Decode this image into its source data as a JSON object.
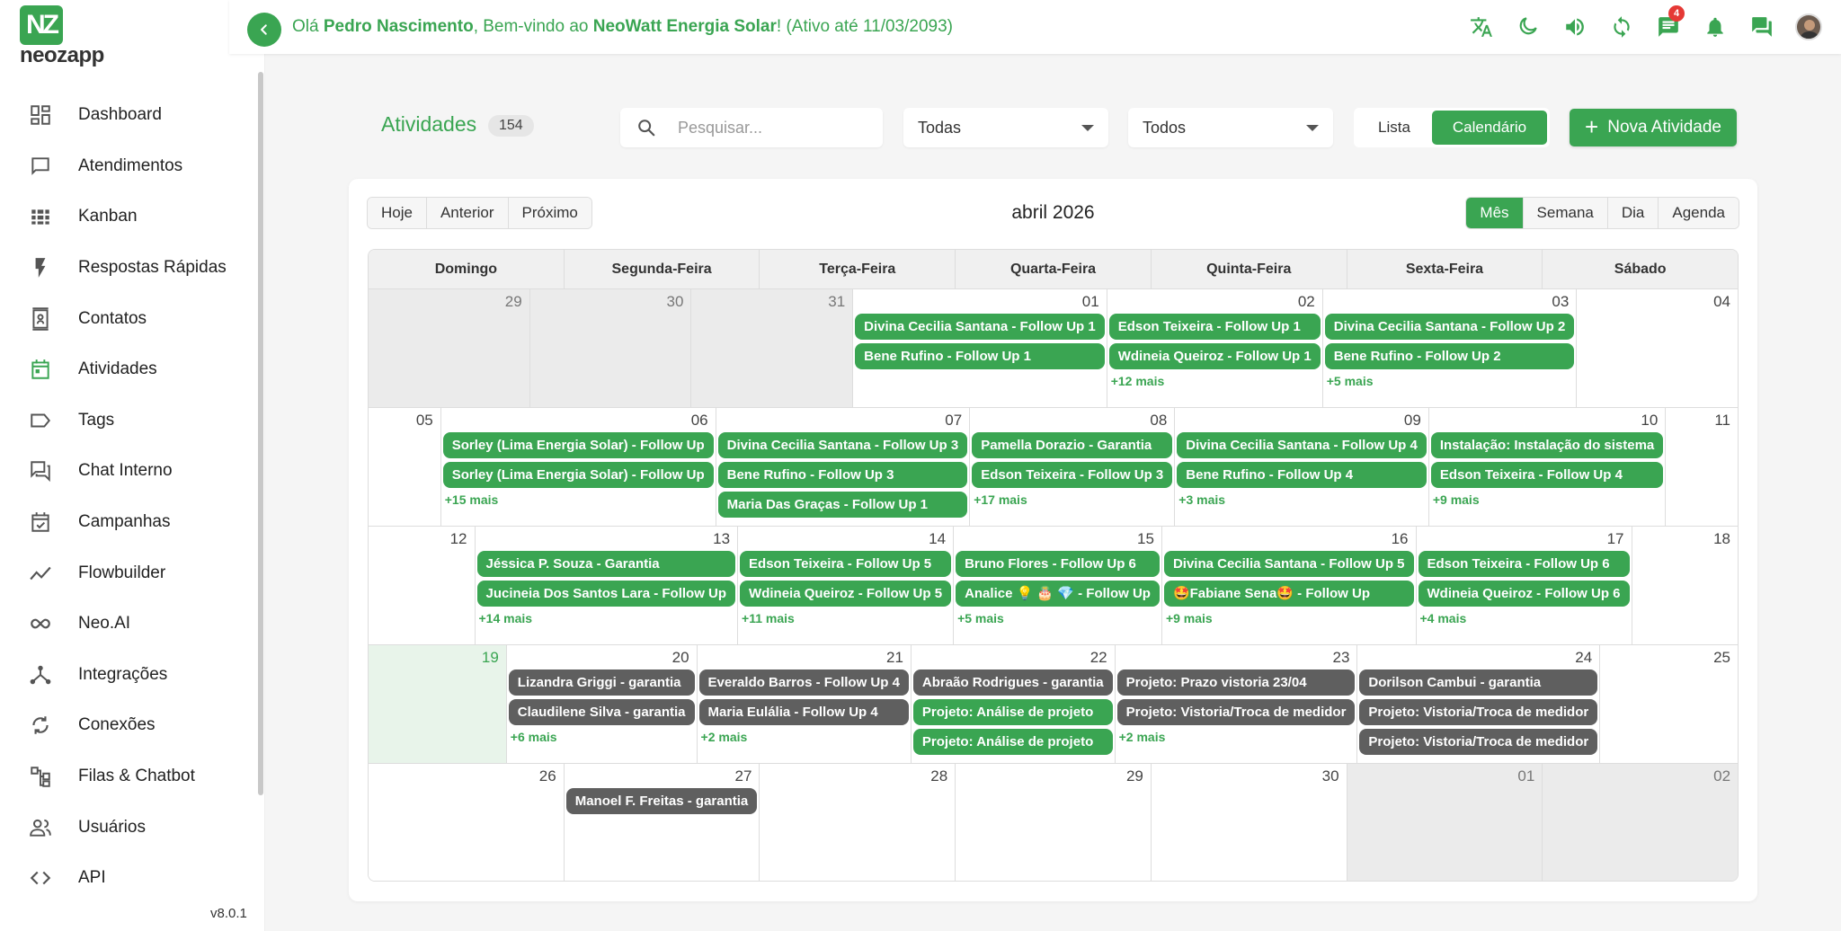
{
  "brand": {
    "logo_mark": "NZ",
    "logo_text": "neozapp",
    "version": "v8.0.1",
    "accent": "#3aa552"
  },
  "sidebar": {
    "items": [
      {
        "label": "Dashboard",
        "icon": "dashboard-icon"
      },
      {
        "label": "Atendimentos",
        "icon": "chat-bubble-icon"
      },
      {
        "label": "Kanban",
        "icon": "grid-icon"
      },
      {
        "label": "Respostas Rápidas",
        "icon": "bolt-icon"
      },
      {
        "label": "Contatos",
        "icon": "contacts-icon"
      },
      {
        "label": "Atividades",
        "icon": "calendar-icon"
      },
      {
        "label": "Tags",
        "icon": "tag-icon"
      },
      {
        "label": "Chat Interno",
        "icon": "forum-icon"
      },
      {
        "label": "Campanhas",
        "icon": "event-check-icon"
      },
      {
        "label": "Flowbuilder",
        "icon": "timeline-icon"
      },
      {
        "label": "Neo.AI",
        "icon": "infinity-icon"
      },
      {
        "label": "Integrações",
        "icon": "hub-icon"
      },
      {
        "label": "Conexões",
        "icon": "sync-icon"
      },
      {
        "label": "Filas & Chatbot",
        "icon": "flowchart-icon"
      },
      {
        "label": "Usuários",
        "icon": "users-icon"
      },
      {
        "label": "API",
        "icon": "code-icon"
      }
    ]
  },
  "header": {
    "greeting_prefix": "Olá ",
    "user_name": "Pedro Nascimento",
    "greeting_mid": ", Bem-vindo ao ",
    "company": "NeoWatt Energia Solar",
    "greeting_suffix": "! (Ativo até 11/03/2093)",
    "chat_badge": "4",
    "icons": [
      "translate-icon",
      "dark-mode-icon",
      "volume-icon",
      "refresh-icon",
      "chat-icon",
      "bell-icon",
      "forum-icon"
    ]
  },
  "toolbar": {
    "title": "Atividades",
    "count": "154",
    "search_placeholder": "Pesquisar...",
    "filter1": "Todas",
    "filter2": "Todos",
    "view_list": "Lista",
    "view_calendar": "Calendário",
    "new_activity": "Nova Atividade"
  },
  "calendar": {
    "nav": [
      "Hoje",
      "Anterior",
      "Próximo"
    ],
    "title": "abril 2026",
    "modes": [
      "Mês",
      "Semana",
      "Dia",
      "Agenda"
    ],
    "weekdays": [
      "Domingo",
      "Segunda-Feira",
      "Terça-Feira",
      "Quarta-Feira",
      "Quinta-Feira",
      "Sexta-Feira",
      "Sábado"
    ],
    "weeks": [
      [
        {
          "day": "29",
          "muted": true,
          "events": []
        },
        {
          "day": "30",
          "muted": true,
          "events": []
        },
        {
          "day": "31",
          "muted": true,
          "events": []
        },
        {
          "day": "01",
          "events": [
            {
              "t": "Divina Cecilia Santana - Follow Up 1"
            },
            {
              "t": "Bene Rufino - Follow Up 1"
            }
          ]
        },
        {
          "day": "02",
          "events": [
            {
              "t": "Edson Teixeira - Follow Up 1"
            },
            {
              "t": "Wdineia Queiroz - Follow Up 1"
            }
          ],
          "more": "+12 mais"
        },
        {
          "day": "03",
          "events": [
            {
              "t": "Divina Cecilia Santana - Follow Up 2"
            },
            {
              "t": "Bene Rufino - Follow Up 2"
            }
          ],
          "more": "+5 mais"
        },
        {
          "day": "04",
          "events": []
        }
      ],
      [
        {
          "day": "05",
          "events": []
        },
        {
          "day": "06",
          "events": [
            {
              "t": "Sorley (Lima Energia Solar) - Follow Up"
            },
            {
              "t": "Sorley (Lima Energia Solar) - Follow Up"
            }
          ],
          "more": "+15 mais"
        },
        {
          "day": "07",
          "events": [
            {
              "t": "Divina Cecilia Santana - Follow Up 3"
            },
            {
              "t": "Bene Rufino - Follow Up 3"
            },
            {
              "t": "Maria Das Graças - Follow Up 1"
            }
          ]
        },
        {
          "day": "08",
          "events": [
            {
              "t": "Pamella Dorazio - Garantia"
            },
            {
              "t": "Edson Teixeira - Follow Up 3"
            }
          ],
          "more": "+17 mais"
        },
        {
          "day": "09",
          "events": [
            {
              "t": "Divina Cecilia Santana - Follow Up 4"
            },
            {
              "t": "Bene Rufino - Follow Up 4"
            }
          ],
          "more": "+3 mais"
        },
        {
          "day": "10",
          "events": [
            {
              "t": "Instalação: Instalação do sistema"
            },
            {
              "t": "Edson Teixeira - Follow Up 4"
            }
          ],
          "more": "+9 mais"
        },
        {
          "day": "11",
          "events": []
        }
      ],
      [
        {
          "day": "12",
          "events": []
        },
        {
          "day": "13",
          "events": [
            {
              "t": "Jéssica P. Souza - Garantia"
            },
            {
              "t": "Jucineia Dos Santos Lara - Follow Up"
            }
          ],
          "more": "+14 mais"
        },
        {
          "day": "14",
          "events": [
            {
              "t": "Edson Teixeira - Follow Up 5"
            },
            {
              "t": "Wdineia Queiroz - Follow Up 5"
            }
          ],
          "more": "+11 mais"
        },
        {
          "day": "15",
          "events": [
            {
              "t": "Bruno Flores - Follow Up 6"
            },
            {
              "t": "Analice 💡 🎂 💎 - Follow Up"
            }
          ],
          "more": "+5 mais"
        },
        {
          "day": "16",
          "events": [
            {
              "t": "Divina Cecilia Santana - Follow Up 5"
            },
            {
              "t": "🤩Fabiane Sena🤩 - Follow Up"
            }
          ],
          "more": "+9 mais"
        },
        {
          "day": "17",
          "events": [
            {
              "t": "Edson Teixeira - Follow Up 6"
            },
            {
              "t": "Wdineia Queiroz - Follow Up 6"
            }
          ],
          "more": "+4 mais"
        },
        {
          "day": "18",
          "events": []
        }
      ],
      [
        {
          "day": "19",
          "today": true,
          "events": []
        },
        {
          "day": "20",
          "events": [
            {
              "t": "Lizandra Griggi - garantia",
              "dark": true
            },
            {
              "t": "Claudilene Silva - garantia",
              "dark": true
            }
          ],
          "more": "+6 mais"
        },
        {
          "day": "21",
          "events": [
            {
              "t": "Everaldo Barros - Follow Up 4",
              "dark": true
            },
            {
              "t": "Maria Eulália - Follow Up 4",
              "dark": true
            }
          ],
          "more": "+2 mais"
        },
        {
          "day": "22",
          "events": [
            {
              "t": "Abraão Rodrigues - garantia",
              "dark": true
            },
            {
              "t": "Projeto: Análise de projeto"
            },
            {
              "t": "Projeto: Análise de projeto"
            }
          ]
        },
        {
          "day": "23",
          "events": [
            {
              "t": "Projeto: Prazo vistoria 23/04",
              "dark": true
            },
            {
              "t": "Projeto: Vistoria/Troca de medidor",
              "dark": true
            }
          ],
          "more": "+2 mais"
        },
        {
          "day": "24",
          "events": [
            {
              "t": "Dorilson Cambui - garantia",
              "dark": true
            },
            {
              "t": "Projeto: Vistoria/Troca de medidor",
              "dark": true
            },
            {
              "t": "Projeto: Vistoria/Troca de medidor",
              "dark": true
            }
          ]
        },
        {
          "day": "25",
          "events": []
        }
      ],
      [
        {
          "day": "26",
          "events": []
        },
        {
          "day": "27",
          "events": [
            {
              "t": "Manoel F. Freitas - garantia",
              "dark": true
            }
          ]
        },
        {
          "day": "28",
          "events": []
        },
        {
          "day": "29",
          "events": []
        },
        {
          "day": "30",
          "events": []
        },
        {
          "day": "01",
          "muted": true,
          "events": []
        },
        {
          "day": "02",
          "muted": true,
          "events": []
        }
      ]
    ]
  }
}
